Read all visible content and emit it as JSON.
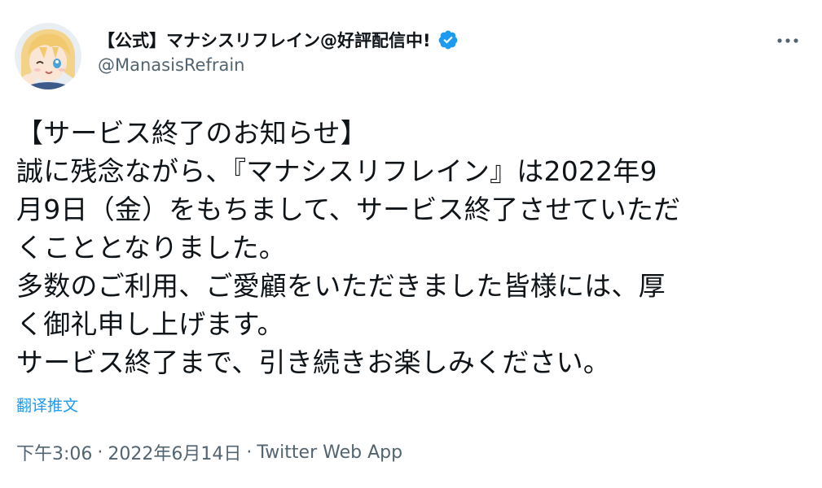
{
  "author": {
    "display_name": "【公式】マナシスリフレイン@好評配信中!",
    "handle": "@ManasisRefrain",
    "verified": true,
    "avatar_icon": "anime-character-avatar-icon"
  },
  "menu": {
    "more_icon": "more-horizontal-icon"
  },
  "tweet": {
    "lines": [
      "【サービス終了のお知らせ】",
      "誠に残念ながら、『マナシスリフレイン』は2022年9",
      "月9日（金）をもちまして、サービス終了させていただ",
      "くこととなりました。",
      "多数のご利用、ご愛顧をいただきました皆様には、厚",
      "く御礼申し上げます。",
      "サービス終了まで、引き続きお楽しみください。"
    ],
    "translate_label": "翻译推文"
  },
  "meta": {
    "time": "下午3:06",
    "date": "2022年6月14日",
    "source": "Twitter Web App",
    "separator": "·"
  },
  "colors": {
    "accent": "#1d9bf0",
    "text": "#0f1419",
    "secondary": "#536471"
  }
}
